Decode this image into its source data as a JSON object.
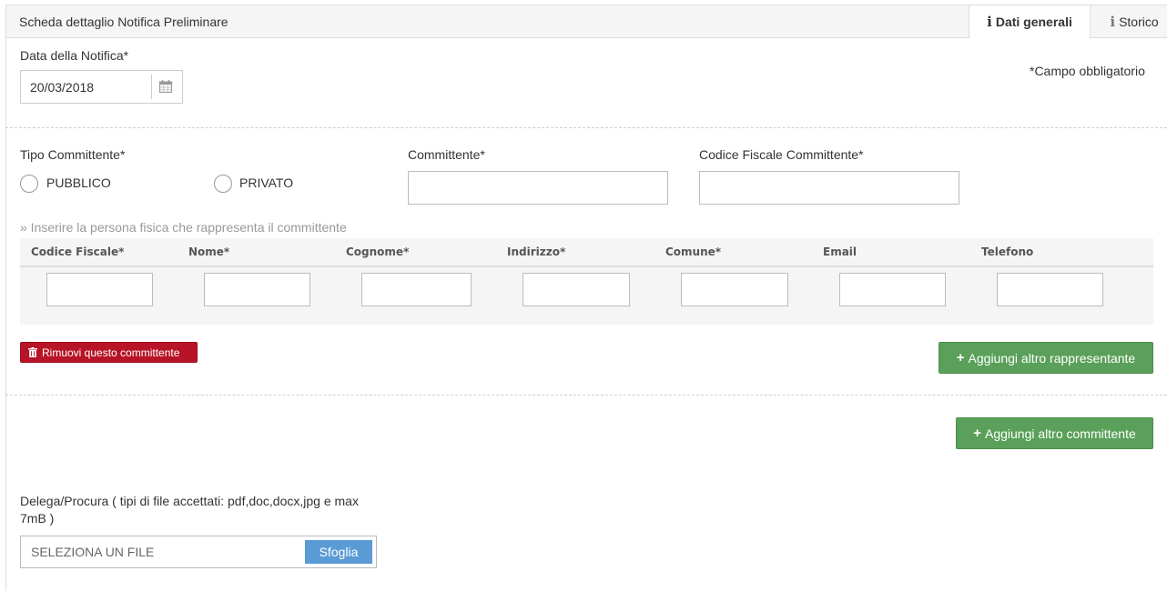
{
  "header": {
    "title": "Scheda dettaglio Notifica Preliminare",
    "tabs": [
      {
        "label": "Dati generali",
        "icon": "info-icon",
        "active": true
      },
      {
        "label": "Storico",
        "icon": "info-icon",
        "active": false
      }
    ]
  },
  "notifica": {
    "date_label": "Data della Notifica*",
    "date_value": "20/03/2018",
    "required_note": "*Campo obbligatorio"
  },
  "committente": {
    "tipo_label": "Tipo Committente*",
    "options": [
      "PUBBLICO",
      "PRIVATO"
    ],
    "committente_label": "Committente*",
    "codice_fiscale_label": "Codice Fiscale Committente*",
    "hint": "» Inserire la persona fisica che rappresenta il committente",
    "columns": [
      "Codice Fiscale*",
      "Nome*",
      "Cognome*",
      "Indirizzo*",
      "Comune*",
      "Email",
      "Telefono"
    ],
    "remove_label": "Rimuovi questo committente",
    "add_rep_label": "Aggiungi altro rappresentante"
  },
  "add_committente_label": "Aggiungi altro committente",
  "delega": {
    "label_line1": "Delega/Procura ( tipi di file accettati: pdf,doc,docx,jpg e max",
    "label_line2": "7mB )",
    "placeholder": "SELEZIONA UN FILE",
    "browse_label": "Sfoglia"
  },
  "colors": {
    "danger": "#b71427",
    "success": "#5aa05a",
    "primary": "#5b9bd5"
  }
}
